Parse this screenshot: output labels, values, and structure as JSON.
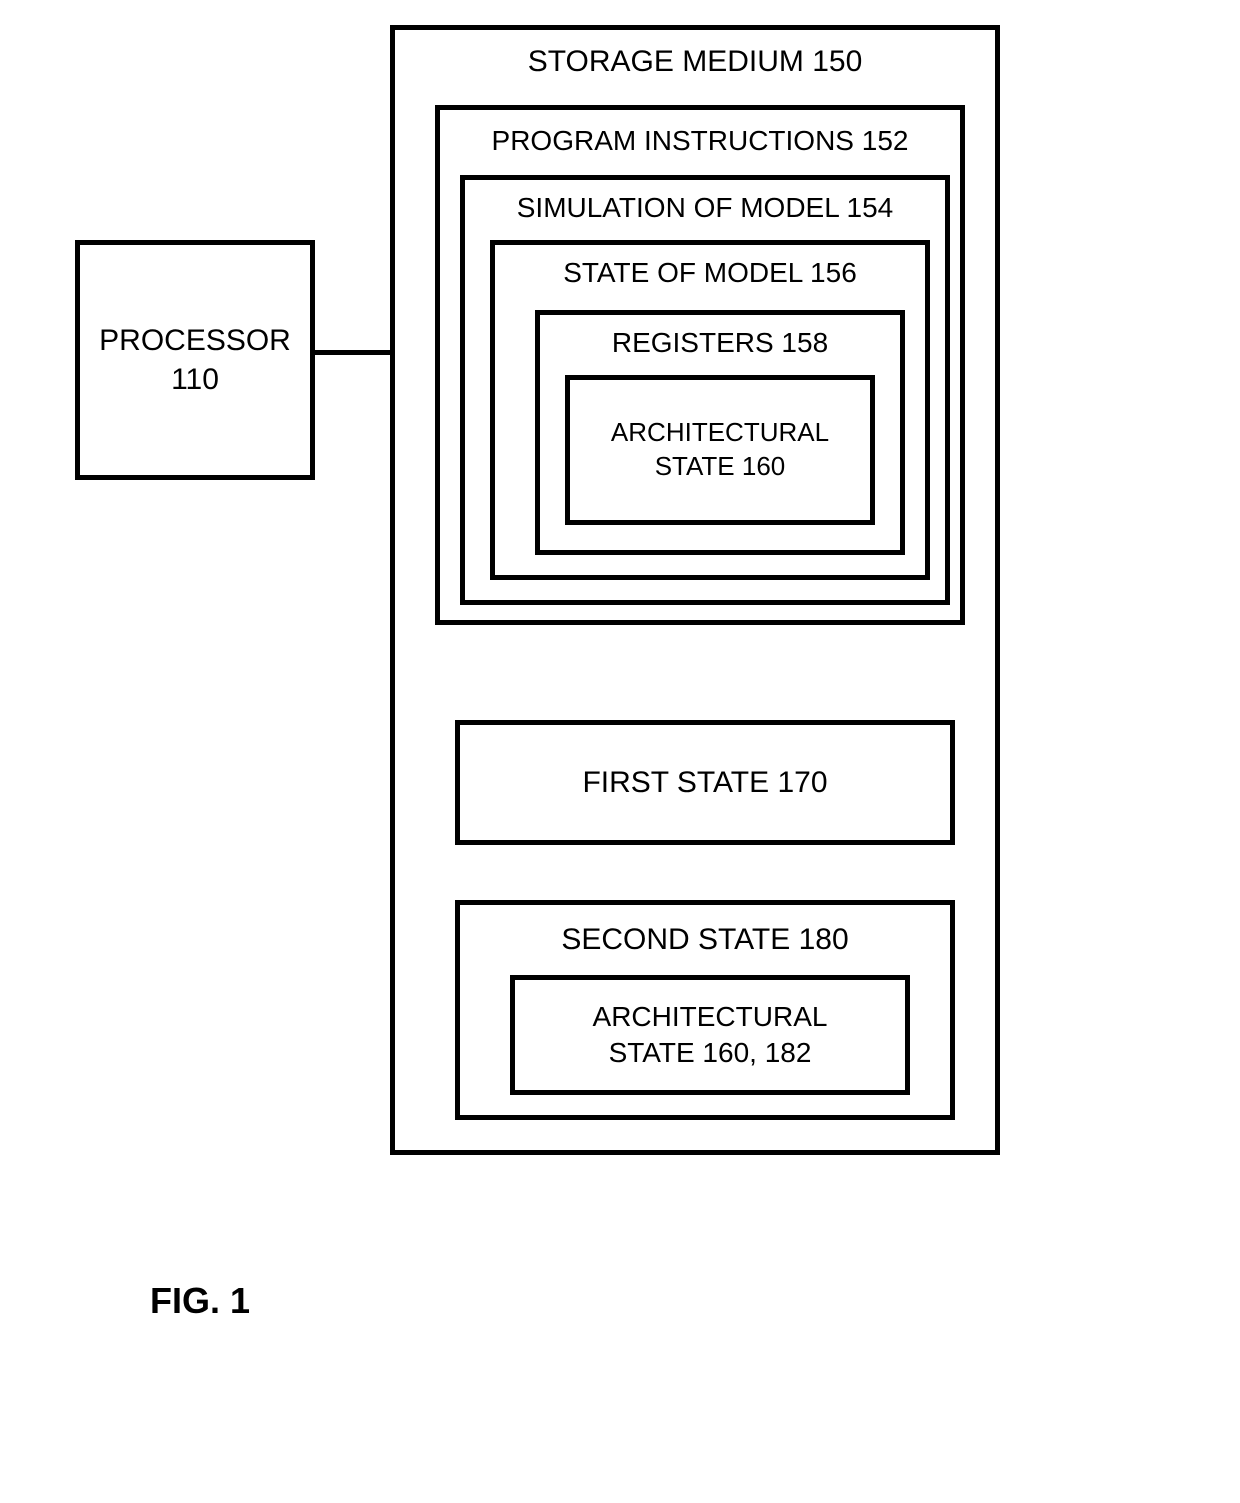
{
  "processor": {
    "label": "PROCESSOR",
    "ref": "110"
  },
  "storage": {
    "title": "STORAGE MEDIUM 150",
    "program": {
      "title": "PROGRAM INSTRUCTIONS 152",
      "simulation": {
        "title": "SIMULATION OF MODEL 154",
        "state_model": {
          "title": "STATE OF MODEL 156",
          "registers": {
            "title": "REGISTERS 158",
            "arch_state": {
              "line1": "ARCHITECTURAL",
              "line2": "STATE 160"
            }
          }
        }
      }
    },
    "first_state": {
      "label": "FIRST STATE 170"
    },
    "second_state": {
      "title": "SECOND STATE 180",
      "arch_state": {
        "line1": "ARCHITECTURAL",
        "line2": "STATE 160, 182"
      }
    }
  },
  "figure_label": "FIG. 1"
}
